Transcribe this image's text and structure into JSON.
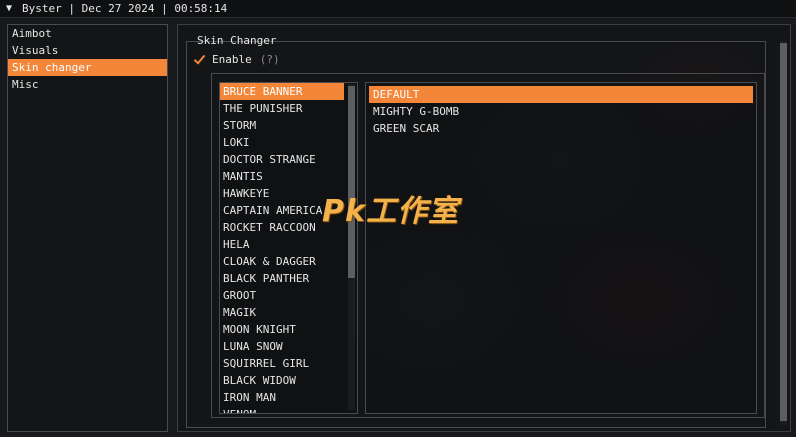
{
  "titlebar": {
    "collapse_icon": "triangle-down-icon",
    "text": "Byster | Dec 27 2024 | 00:58:14"
  },
  "nav": {
    "items": [
      {
        "label": "Aimbot",
        "active": false
      },
      {
        "label": "Visuals",
        "active": false
      },
      {
        "label": "Skin changer",
        "active": true
      },
      {
        "label": "Misc",
        "active": false
      }
    ]
  },
  "skin_changer": {
    "title": "Skin Changer",
    "enable_label": "Enable",
    "enable_checked": true,
    "help_label": "(?)",
    "heroes": [
      "BRUCE BANNER",
      "THE PUNISHER",
      "STORM",
      "LOKI",
      "DOCTOR STRANGE",
      "MANTIS",
      "HAWKEYE",
      "CAPTAIN AMERICA",
      "ROCKET RACCOON",
      "HELA",
      "CLOAK & DAGGER",
      "BLACK PANTHER",
      "GROOT",
      "MAGIK",
      "MOON KNIGHT",
      "LUNA SNOW",
      "SQUIRREL GIRL",
      "BLACK WIDOW",
      "IRON MAN",
      "VENOM"
    ],
    "selected_hero": "BRUCE BANNER",
    "skins": [
      "DEFAULT",
      "MIGHTY G-BOMB",
      "GREEN SCAR"
    ],
    "selected_skin": "DEFAULT"
  },
  "watermark": "Pk工作室",
  "colors": {
    "accent": "#f4863a",
    "background": "#15171a",
    "border": "#4a4b4f"
  }
}
